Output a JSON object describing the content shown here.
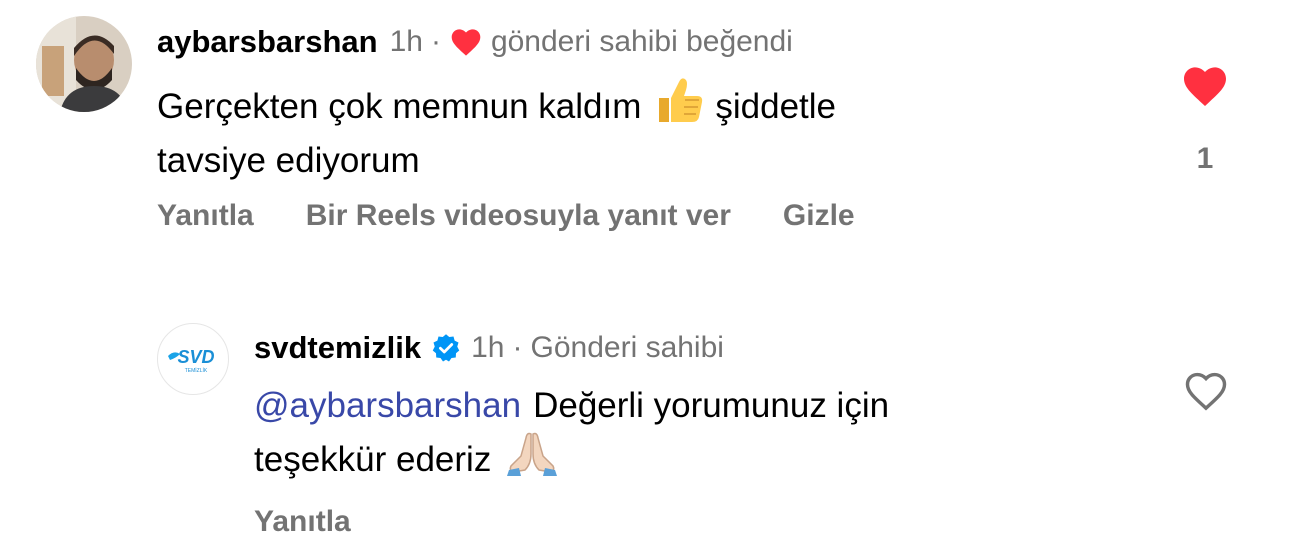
{
  "comment": {
    "username": "aybarsbarshan",
    "time": "1h",
    "dot": "·",
    "liked_by_author": "gönderi sahibi beğendi",
    "text_line1": "Gerçekten çok memnun kaldım",
    "text_line1_after": "şiddetle",
    "text_line2": "tavsiye ediyorum",
    "like_count": "1",
    "actions": {
      "reply": "Yanıtla",
      "reels_reply": "Bir Reels videosuyla yanıt ver",
      "hide": "Gizle"
    },
    "liked": true
  },
  "reply": {
    "username": "svdtemizlik",
    "verified": true,
    "time": "1h",
    "dot": "·",
    "author_label": "Gönderi sahibi",
    "mention": "@aybarsbarshan",
    "text_line1": "Değerli yorumunuz için",
    "text_line2": "teşekkür ederiz",
    "avatar_logo": "SVD",
    "avatar_sub": "TEMİZLİK",
    "actions": {
      "reply": "Yanıtla"
    },
    "liked": false
  },
  "colors": {
    "like_red": "#ff3040",
    "muted": "#737373",
    "mention": "#3948a8",
    "verified": "#0095f6"
  }
}
